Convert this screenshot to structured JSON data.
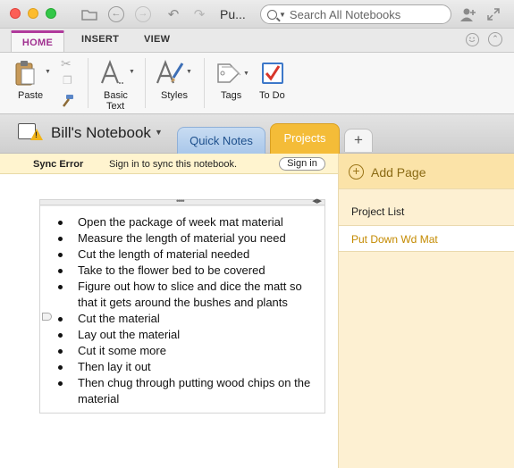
{
  "window": {
    "title": "Pu...",
    "search_placeholder": "Search All Notebooks"
  },
  "ribbon_tabs": [
    "HOME",
    "INSERT",
    "VIEW"
  ],
  "ribbon": {
    "paste": "Paste",
    "basic_text_line1": "Basic",
    "basic_text_line2": "Text",
    "styles": "Styles",
    "tags": "Tags",
    "todo": "To Do"
  },
  "notebook": {
    "name": "Bill's Notebook",
    "sections": [
      "Quick Notes",
      "Projects"
    ],
    "add_section": "+"
  },
  "sync": {
    "error_label": "Sync Error",
    "message": "Sign in to sync this notebook.",
    "signin_button": "Sign in"
  },
  "pages_pane": {
    "add_page": "Add Page",
    "pages": [
      "Project List",
      "Put Down Wd Mat"
    ],
    "selected_index": 1
  },
  "note": {
    "items": [
      "Open the package of week mat material",
      "Measure the length of material you need",
      "Cut the length of material needed",
      "Take to the flower bed to be covered",
      "Figure out how to slice and dice the matt so that it gets around the bushes and plants",
      "Cut the material",
      "Lay out the material",
      "Cut it some more",
      "Then lay it out",
      "Then chug through putting wood chips on the material"
    ]
  },
  "colors": {
    "home_tab_accent": "#b03a9c",
    "projects_section": "#f4bc38",
    "quick_notes_section": "#a9c7ea",
    "selected_page_text": "#c48a00"
  }
}
